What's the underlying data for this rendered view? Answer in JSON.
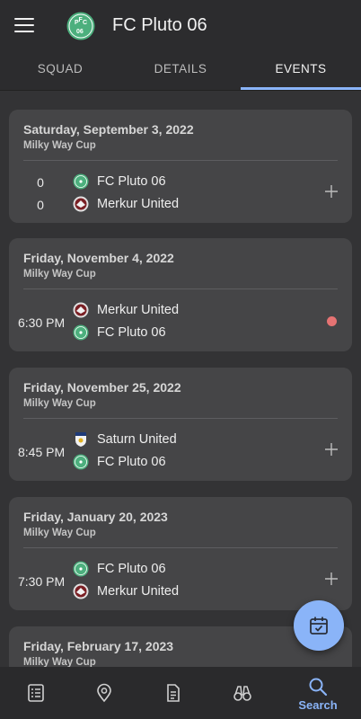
{
  "header": {
    "title": "FC Pluto 06",
    "logo_text": "PFC06"
  },
  "tabs": [
    {
      "label": "SQUAD",
      "active": false
    },
    {
      "label": "DETAILS",
      "active": false
    },
    {
      "label": "EVENTS",
      "active": true
    }
  ],
  "events": [
    {
      "date": "Saturday, September 3, 2022",
      "competition": "Milky Way Cup",
      "home": {
        "name": "FC Pluto 06",
        "score": "0"
      },
      "away": {
        "name": "Merkur United",
        "score": "0"
      }
    },
    {
      "date": "Friday, November 4, 2022",
      "competition": "Milky Way Cup",
      "time": "6:30 PM",
      "home": {
        "name": "Merkur United"
      },
      "away": {
        "name": "FC Pluto 06"
      }
    },
    {
      "date": "Friday, November 25, 2022",
      "competition": "Milky Way Cup",
      "time": "8:45 PM",
      "home": {
        "name": "Saturn United"
      },
      "away": {
        "name": "FC Pluto 06"
      }
    },
    {
      "date": "Friday, January 20, 2023",
      "competition": "Milky Way Cup",
      "time": "7:30 PM",
      "home": {
        "name": "FC Pluto 06"
      },
      "away": {
        "name": "Merkur United"
      }
    },
    {
      "date": "Friday, February 17, 2023",
      "competition": "Milky Way Cup"
    }
  ],
  "bottom_nav": [
    {
      "icon": "list-document-icon"
    },
    {
      "icon": "location-pin-icon"
    },
    {
      "icon": "document-icon"
    },
    {
      "icon": "binoculars-icon"
    },
    {
      "icon": "search-icon",
      "label": "Search",
      "active": true
    }
  ],
  "colors": {
    "accent": "#8ab4f8",
    "card": "#454547",
    "background": "#333335",
    "live": "#e57373",
    "pluto_green": "#4caf7d"
  }
}
